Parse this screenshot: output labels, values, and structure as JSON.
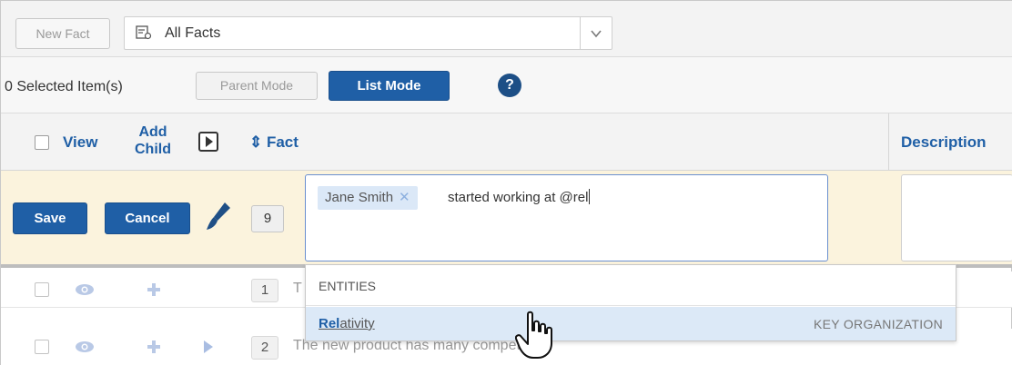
{
  "toolbar": {
    "new_fact_label": "New Fact",
    "view_selector_label": "All Facts"
  },
  "selection_bar": {
    "count_text": "0  Selected Item(s)",
    "parent_mode_label": "Parent Mode",
    "list_mode_label": "List Mode",
    "help_label": "?"
  },
  "header": {
    "view_label": "View",
    "add_child_label_line1": "Add",
    "add_child_label_line2": "Child",
    "fact_label": "⇕ Fact",
    "description_label": "Description"
  },
  "edit_row": {
    "save_label": "Save",
    "cancel_label": "Cancel",
    "row_number": "9",
    "mention_pill": "Jane Smith",
    "mention_remove": "✕",
    "typed_text": "started working at @rel"
  },
  "rows": [
    {
      "number": "1",
      "text": "T"
    },
    {
      "number": "2",
      "text": "The new product has many competitors."
    }
  ],
  "dropdown": {
    "section_header": "ENTITIES",
    "item_name_match": "Rel",
    "item_name_rest": "ativity",
    "item_category": "KEY ORGANIZATION"
  },
  "colors": {
    "primary_button": "#1f5fa6",
    "header_link": "#1f5fa6",
    "edit_row_bg": "#fbf3dd",
    "dropdown_highlight": "#dce9f7"
  }
}
